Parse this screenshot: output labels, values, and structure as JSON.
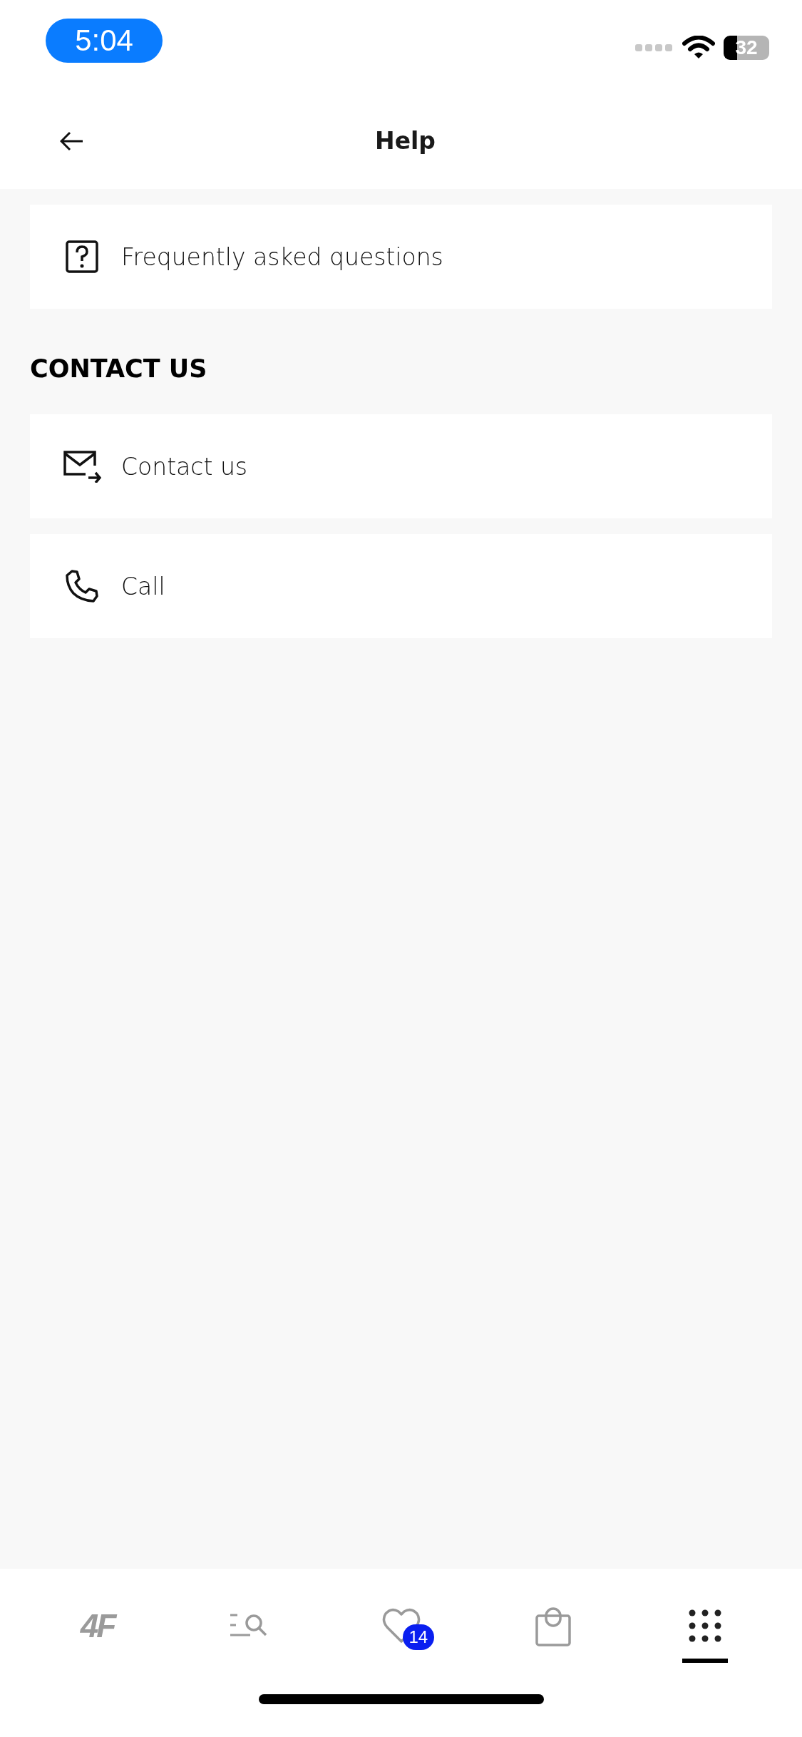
{
  "status_bar": {
    "time": "5:04",
    "battery": "32"
  },
  "header": {
    "title": "Help"
  },
  "top_items": [
    {
      "kind": "faq",
      "label": "Frequently asked questions"
    }
  ],
  "contact_section": {
    "heading": "CONTACT US",
    "items": [
      {
        "kind": "mail",
        "label": "Contact us"
      },
      {
        "kind": "phone",
        "label": "Call"
      }
    ]
  },
  "tab_bar": [
    {
      "kind": "logo",
      "label": "4F",
      "selected": false
    },
    {
      "kind": "search",
      "selected": false
    },
    {
      "kind": "wishlist",
      "badge": "14",
      "selected": false
    },
    {
      "kind": "bag",
      "selected": false
    },
    {
      "kind": "more",
      "selected": true
    }
  ]
}
